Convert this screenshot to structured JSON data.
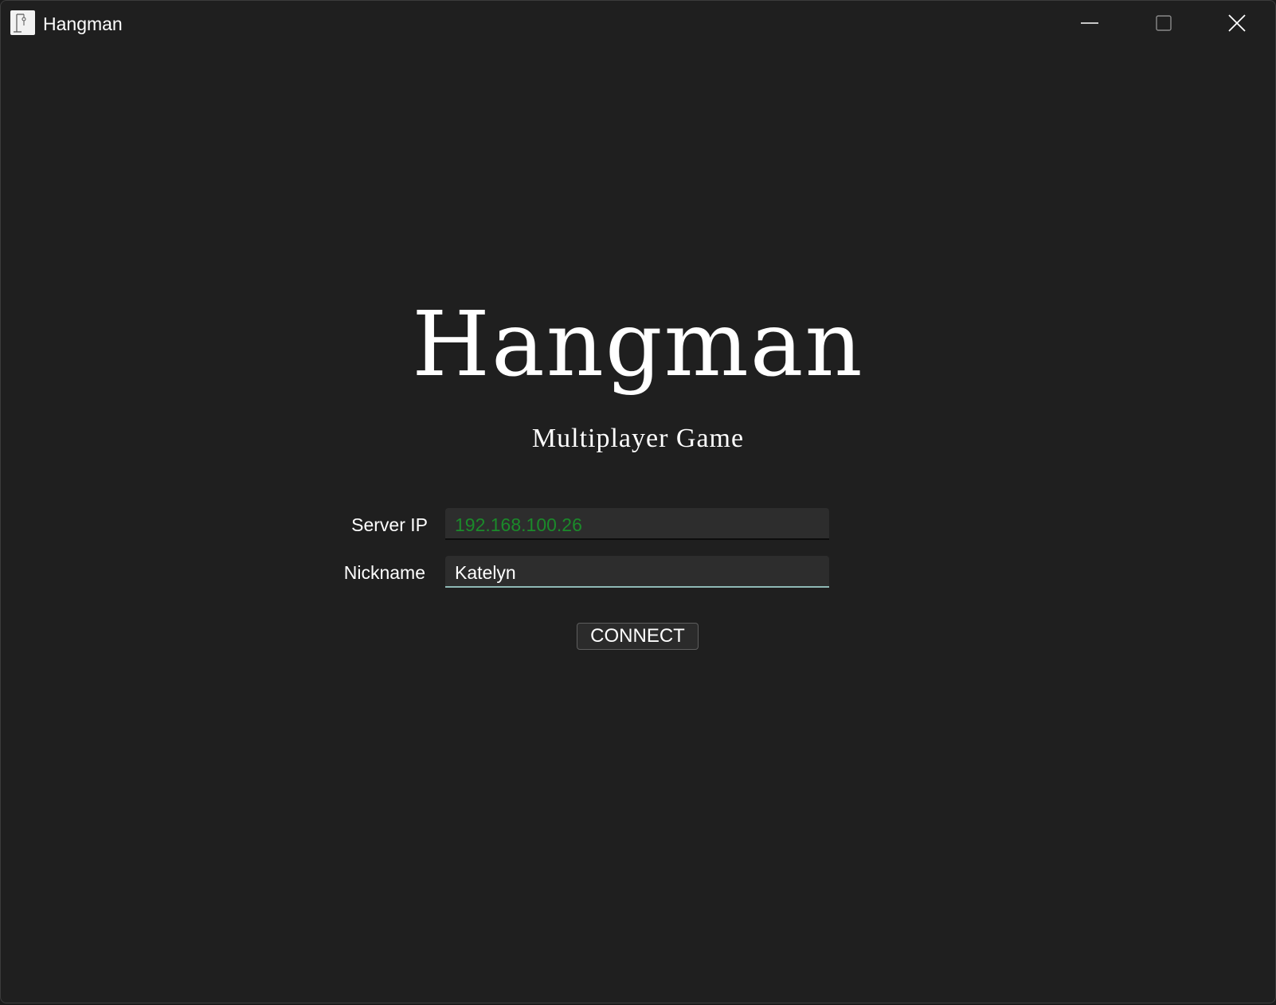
{
  "window": {
    "title": "Hangman",
    "icon": "hangman-app-icon",
    "controls": {
      "minimize_icon": "minimize-icon",
      "maximize_icon": "maximize-icon",
      "close_icon": "close-icon"
    }
  },
  "main": {
    "title": "Hangman",
    "subtitle": "Multiplayer Game",
    "form": {
      "server_ip_label": "Server IP",
      "server_ip_value": "192.168.100.26",
      "nickname_label": "Nickname",
      "nickname_value": "Katelyn",
      "connect_label": "CONNECT"
    }
  },
  "colors": {
    "background": "#1f1f1f",
    "input_background": "#2d2d2d",
    "server_ip_text": "#1b8a2a",
    "focused_underline": "#8fb9b5",
    "text": "#ffffff"
  }
}
